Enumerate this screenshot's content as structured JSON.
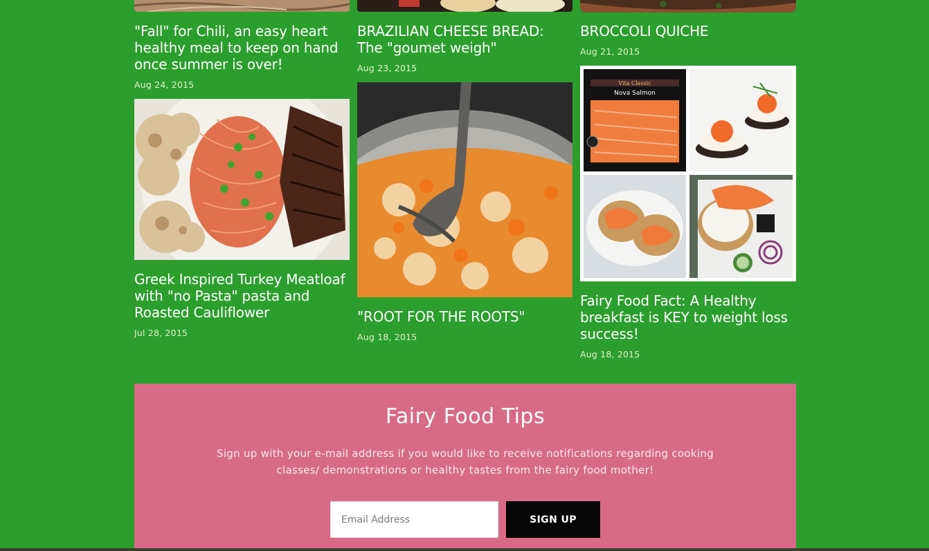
{
  "posts": [
    {
      "title": "\"Fall\" for Chili, an easy heart healthy meal to keep on hand once summer is over!",
      "date": "Aug 24, 2015"
    },
    {
      "title": "BRAZILIAN CHEESE BREAD: The \"goumet weigh\"",
      "date": "Aug 23, 2015"
    },
    {
      "title": "BROCCOLI QUICHE",
      "date": "Aug 21, 2015"
    },
    {
      "title": "Greek Inspired Turkey Meatloaf with \"no Pasta\" pasta and Roasted Cauliflower",
      "date": "Jul 28, 2015"
    },
    {
      "title": "\"ROOT FOR THE ROOTS\"",
      "date": "Aug 18, 2015"
    },
    {
      "title": "Fairy Food Fact: A Healthy breakfast is KEY to weight loss success!",
      "date": "Aug 18, 2015"
    }
  ],
  "images": {
    "salmon_brand": "Vita Classic",
    "salmon_product": "Nova Salmon"
  },
  "signup": {
    "title": "Fairy Food Tips",
    "description": "Sign up with your e-mail address if you would like to receive notifications regarding cooking classes/ demonstrations or healthy tastes from the fairy food mother!",
    "email_placeholder": "Email Address",
    "button_label": "SIGN UP"
  },
  "colors": {
    "page_background": "#2c9e2e",
    "signup_background": "#d76b87",
    "button_background": "#060606"
  }
}
